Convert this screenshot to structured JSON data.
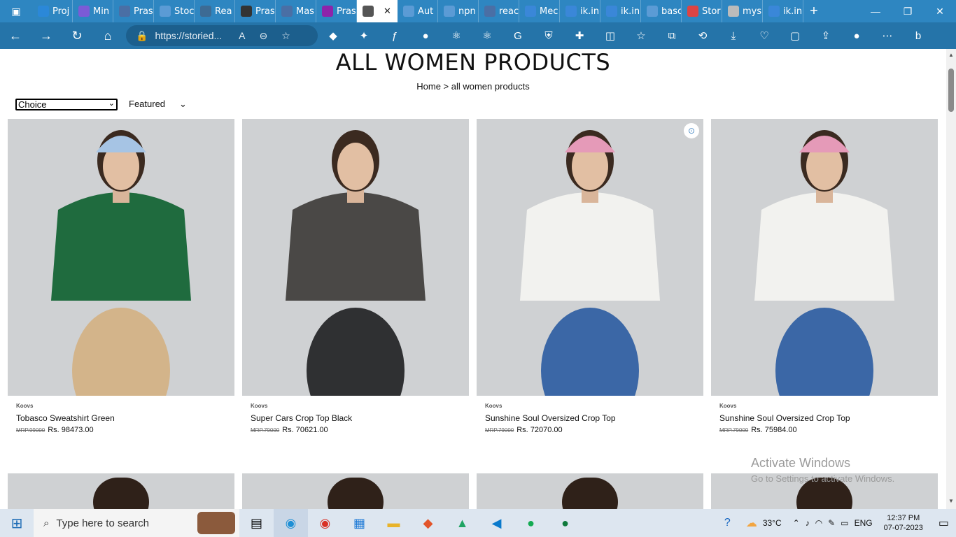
{
  "browser": {
    "tabs": [
      {
        "label": "Proj",
        "icon": "edge-icon",
        "color": "#2b88d8"
      },
      {
        "label": "Min",
        "icon": "app-icon",
        "color": "#7b5bd6"
      },
      {
        "label": "Pras",
        "icon": "pdf-doc-icon",
        "color": "#4a6fa5"
      },
      {
        "label": "Stoc",
        "icon": "globe-icon",
        "color": "#5b9bd5"
      },
      {
        "label": "Rea",
        "icon": "react-icon",
        "color": "#3d6b94"
      },
      {
        "label": "Pras",
        "icon": "github-icon",
        "color": "#333"
      },
      {
        "label": "Mas",
        "icon": "doc-icon",
        "color": "#4a6fa5"
      },
      {
        "label": "Pras",
        "icon": "p-icon",
        "color": "#8e24aa"
      },
      {
        "label": "",
        "icon": "doc-icon",
        "color": "#555"
      },
      {
        "label": "Aut",
        "icon": "globe-icon",
        "color": "#5b9bd5"
      },
      {
        "label": "npn",
        "icon": "search-icon",
        "color": "#5b9bd5"
      },
      {
        "label": "reac",
        "icon": "doc-icon",
        "color": "#4a6fa5"
      },
      {
        "label": "Mec",
        "icon": "i-icon",
        "color": "#3a87d8"
      },
      {
        "label": "ik.in",
        "icon": "i-icon",
        "color": "#3a87d8"
      },
      {
        "label": "ik.in",
        "icon": "i-icon",
        "color": "#3a87d8"
      },
      {
        "label": "basc",
        "icon": "search-icon",
        "color": "#5b9bd5"
      },
      {
        "label": "Stor",
        "icon": "circle-icon",
        "color": "#d44"
      },
      {
        "label": "mys",
        "icon": "scroll-icon",
        "color": "#bbb"
      },
      {
        "label": "ik.in",
        "icon": "i-icon",
        "color": "#3a87d8"
      }
    ],
    "active_tab_index": 8,
    "url": "https://storied..."
  },
  "page": {
    "title": "ALL WOMEN PRODUCTS",
    "breadcrumb": "Home > all women products",
    "select_value": "Choice",
    "sort_label": "Featured",
    "products": [
      {
        "brand": "Koovs",
        "name": "Tobasco Sweatshirt Green",
        "mrp": "MRP.99000",
        "price": "Rs. 98473.00",
        "top": "#1f6b3e",
        "bottom": "#d3b48a",
        "hat": "#a6c4e4",
        "lens": false
      },
      {
        "brand": "Koovs",
        "name": "Super Cars Crop Top Black",
        "mrp": "MRP.79000",
        "price": "Rs. 70621.00",
        "top": "#4a4846",
        "bottom": "#2f3032",
        "hat": "",
        "lens": false
      },
      {
        "brand": "Koovs",
        "name": "Sunshine Soul Oversized Crop Top",
        "mrp": "MRP.79000",
        "price": "Rs. 72070.00",
        "top": "#f2f2ef",
        "bottom": "#3b67a6",
        "hat": "#e59ab8",
        "lens": true
      },
      {
        "brand": "Koovs",
        "name": "Sunshine Soul Oversized Crop Top",
        "mrp": "MRP.79000",
        "price": "Rs. 75984.00",
        "top": "#f2f2ef",
        "bottom": "#3b67a6",
        "hat": "#e59ab8",
        "lens": false
      }
    ]
  },
  "watermark": {
    "title": "Activate Windows",
    "subtitle": "Go to Settings to activate Windows."
  },
  "taskbar": {
    "search_placeholder": "Type here to search",
    "temperature": "33°C",
    "language": "ENG",
    "time": "12:37 PM",
    "date": "07-07-2023"
  }
}
